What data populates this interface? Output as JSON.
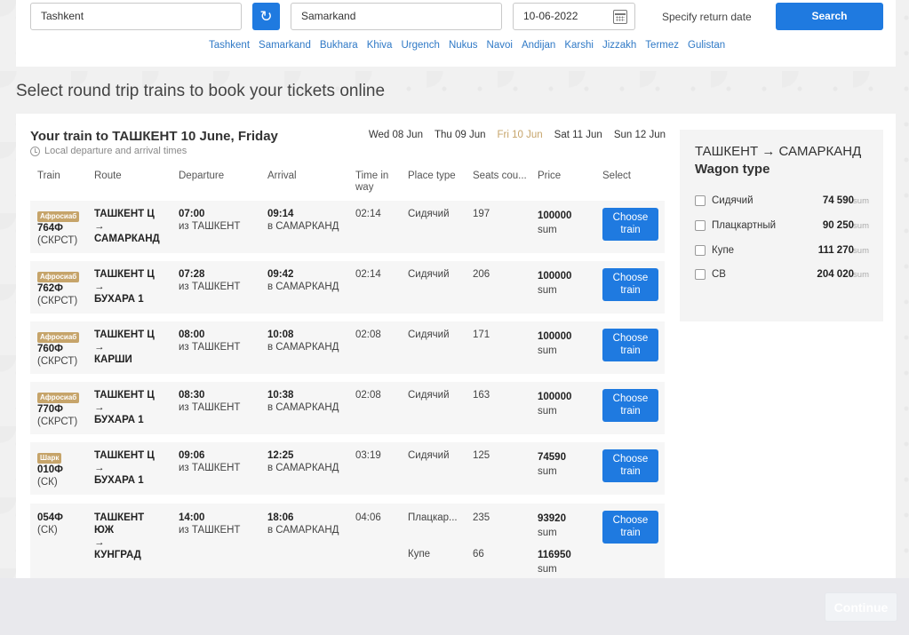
{
  "search": {
    "from": "Tashkent",
    "to": "Samarkand",
    "date": "10-06-2022",
    "return_label": "Specify return date",
    "search_label": "Search",
    "swap_icon": "swap-icon",
    "calendar_icon": "calendar-icon"
  },
  "quick_cities": [
    "Tashkent",
    "Samarkand",
    "Bukhara",
    "Khiva",
    "Urgench",
    "Nukus",
    "Navoi",
    "Andijan",
    "Karshi",
    "Jizzakh",
    "Termez",
    "Gulistan"
  ],
  "page_heading": "Select round trip trains to book your tickets online",
  "trains_panel": {
    "title": "Your train to ТАШКЕНТ 10 June, Friday",
    "local_note": "Local departure and arrival times",
    "dates": [
      {
        "label": "Wed 08 Jun",
        "active": false
      },
      {
        "label": "Thu 09 Jun",
        "active": false
      },
      {
        "label": "Fri 10 Jun",
        "active": true
      },
      {
        "label": "Sat 11 Jun",
        "active": false
      },
      {
        "label": "Sun 12 Jun",
        "active": false
      }
    ],
    "headers": {
      "train": "Train",
      "route": "Route",
      "departure": "Departure",
      "arrival": "Arrival",
      "time_in_way_1": "Time in",
      "time_in_way_2": "way",
      "place_type": "Place type",
      "seats": "Seats cou...",
      "price": "Price",
      "select": "Select"
    },
    "rows": [
      {
        "badge": "Афросиаб",
        "num": "764Ф",
        "cls": "(СКРСТ)",
        "route1": "ТАШКЕНТ Ц",
        "arrow": "→",
        "route2": "САМАРКАНД",
        "dep_time": "07:00",
        "dep_from": "из ТАШКЕНТ",
        "arr_time": "09:14",
        "arr_to": "в САМАРКАНД",
        "duration": "02:14",
        "place": "Сидячий",
        "seats": "197",
        "price": "100000",
        "unit": "sum",
        "btn1": "Choose",
        "btn2": "train"
      },
      {
        "badge": "Афросиаб",
        "num": "762Ф",
        "cls": "(СКРСТ)",
        "route1": "ТАШКЕНТ Ц",
        "arrow": "→",
        "route2": "БУХАРА 1",
        "dep_time": "07:28",
        "dep_from": "из ТАШКЕНТ",
        "arr_time": "09:42",
        "arr_to": "в САМАРКАНД",
        "duration": "02:14",
        "place": "Сидячий",
        "seats": "206",
        "price": "100000",
        "unit": "sum",
        "btn1": "Choose",
        "btn2": "train"
      },
      {
        "badge": "Афросиаб",
        "num": "760Ф",
        "cls": "(СКРСТ)",
        "route1": "ТАШКЕНТ Ц",
        "arrow": "→",
        "route2": "КАРШИ",
        "dep_time": "08:00",
        "dep_from": "из ТАШКЕНТ",
        "arr_time": "10:08",
        "arr_to": "в САМАРКАНД",
        "duration": "02:08",
        "place": "Сидячий",
        "seats": "171",
        "price": "100000",
        "unit": "sum",
        "btn1": "Choose",
        "btn2": "train"
      },
      {
        "badge": "Афросиаб",
        "num": "770Ф",
        "cls": "(СКРСТ)",
        "route1": "ТАШКЕНТ Ц",
        "arrow": "→",
        "route2": "БУХАРА 1",
        "dep_time": "08:30",
        "dep_from": "из ТАШКЕНТ",
        "arr_time": "10:38",
        "arr_to": "в САМАРКАНД",
        "duration": "02:08",
        "place": "Сидячий",
        "seats": "163",
        "price": "100000",
        "unit": "sum",
        "btn1": "Choose",
        "btn2": "train"
      },
      {
        "badge": "Шарк",
        "num": "010Ф",
        "cls": "(СК)",
        "route1": "ТАШКЕНТ Ц",
        "arrow": "→",
        "route2": "БУХАРА 1",
        "dep_time": "09:06",
        "dep_from": "из ТАШКЕНТ",
        "arr_time": "12:25",
        "arr_to": "в САМАРКАНД",
        "duration": "03:19",
        "place": "Сидячий",
        "seats": "125",
        "price": "74590",
        "unit": "sum",
        "btn1": "Choose",
        "btn2": "train"
      }
    ],
    "last_row": {
      "num": "054Ф",
      "cls": "(СК)",
      "route1": "ТАШКЕНТ",
      "route1b": "ЮЖ",
      "arrow": "→",
      "route2": "КУНГРАД",
      "dep_time": "14:00",
      "dep_from": "из ТАШКЕНТ",
      "arr_time": "18:06",
      "arr_to": "в САМАРКАНД",
      "duration": "04:06",
      "place1": "Плацкар...",
      "seats1": "235",
      "price1": "93920",
      "unit": "sum",
      "place2": "Купе",
      "seats2": "66",
      "price2": "116950",
      "btn1": "Choose",
      "btn2": "train"
    }
  },
  "wagon_filter": {
    "route": "ТАШКЕНТ → САМАРКАНД",
    "title": "Wagon type",
    "unit": "sum",
    "items": [
      {
        "name": "Сидячий",
        "price": "74 590"
      },
      {
        "name": "Плацкартный",
        "price": "90 250"
      },
      {
        "name": "Купе",
        "price": "111 270"
      },
      {
        "name": "СВ",
        "price": "204 020"
      }
    ]
  },
  "footer": {
    "continue_label": "Continue"
  }
}
